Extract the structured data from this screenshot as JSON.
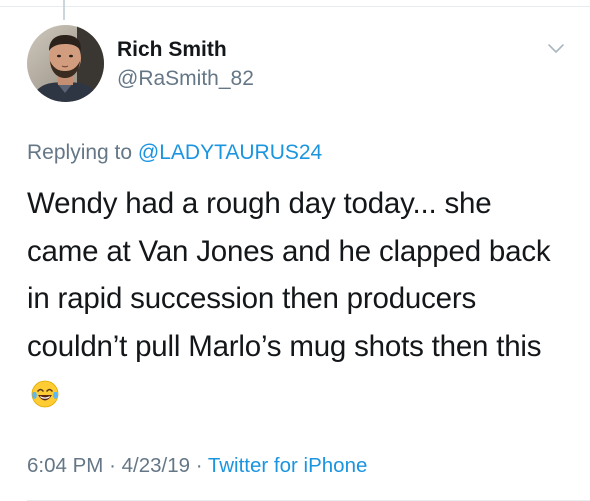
{
  "tweet": {
    "author": {
      "display_name": "Rich Smith",
      "handle": "@RaSmith_82"
    },
    "reply": {
      "prefix": "Replying to",
      "mention": "@LADYTAURUS24"
    },
    "text": "Wendy had a rough day today... she came at Van Jones and he clapped back in rapid succession then producers couldn’t pull Marlo’s mug shots then this",
    "emoji": "face-with-tears-of-joy",
    "time": "6:04 PM",
    "date": "4/23/19",
    "separator": "·",
    "source": "Twitter for iPhone",
    "colors": {
      "link": "#1b95e0",
      "secondary_text": "#657786",
      "primary_text": "#14171a"
    }
  }
}
